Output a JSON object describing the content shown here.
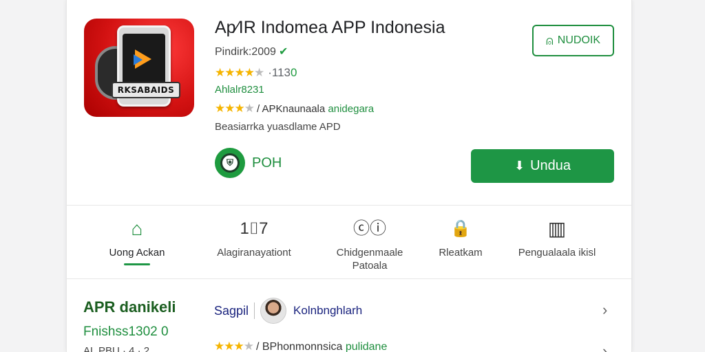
{
  "app": {
    "title": "Ap⁄IR Indomea APP Indonesia",
    "publisher": "Pindirk:2009",
    "verified_icon": "check-icon",
    "rating_stars": 4.5,
    "rating_count_prefix": "·113",
    "rating_count_suffix": "0",
    "green_line": "Ahlalr8231",
    "sub_rating_stars": 4,
    "sub_rating_text": "/ APKnaunaala ",
    "sub_rating_text_green": "anidegara",
    "description": "Beasiarrka yuasdlame APD",
    "icon_badge": "RKSABAIDS"
  },
  "developer": {
    "name": "POH"
  },
  "buttons": {
    "outline_label": "NUDOIK",
    "primary_label": "Undua"
  },
  "tabs": [
    {
      "label": "Uong Ackan",
      "icon": "home-icon",
      "glyph": "⌂"
    },
    {
      "label": "Alagiranayationt",
      "icon": "ranking-icon",
      "glyph": "1⌷7"
    },
    {
      "label": "Chidgenmaale\nPatoala",
      "icon": "chain-icon",
      "glyph": "ⓒⓘ"
    },
    {
      "label": "Rleatkam",
      "icon": "lock-icon",
      "glyph": "🔒"
    },
    {
      "label": "Pengualaala ikisl",
      "icon": "grid-icon",
      "glyph": "▥"
    }
  ],
  "section": {
    "title": "APR danikeli",
    "subtitle": "Fnishss1302 0",
    "sub2": "AL PBU · 4 · 2",
    "author1": "Sagpil",
    "author2": "Kolnbnghlarh",
    "rating_stars": 4,
    "rating_text": "/ BPhonmonnsica ",
    "rating_text_green": "pulidane"
  },
  "colors": {
    "accent": "#1e9645",
    "accent_text": "#1e8e3e",
    "star": "#f5b400"
  }
}
